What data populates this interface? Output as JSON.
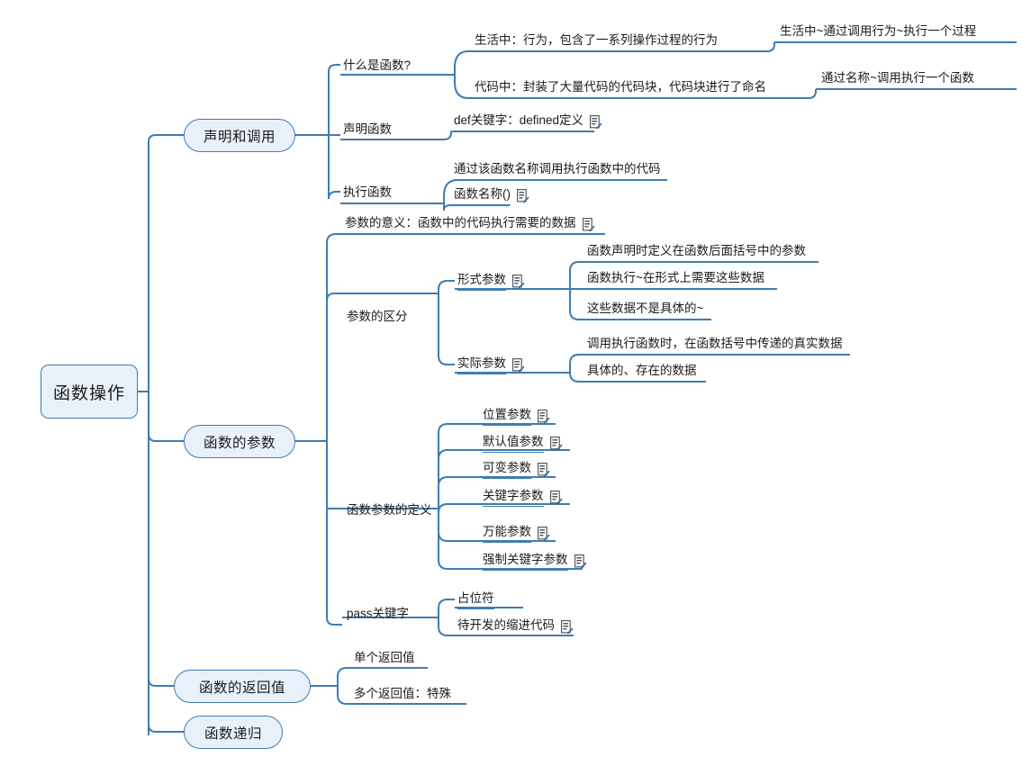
{
  "theme": {
    "node_fill": "#e8f1f9",
    "node_border": "#3f7cb0",
    "line_color": "#3f7cb0",
    "text_color": "#1b1b1b",
    "background": "#ffffff"
  },
  "icons": {
    "note": "note-icon"
  },
  "root": {
    "label": "函数操作"
  },
  "branches": [
    {
      "label": "声明和调用",
      "topics": [
        {
          "label": "什么是函数?",
          "leaves": [
            {
              "text": "生活中：行为，包含了一系列操作过程的行为",
              "note": false,
              "children": [
                {
                  "text": "生活中~通过调用行为~执行一个过程",
                  "note": false
                }
              ]
            },
            {
              "text": "代码中：封装了大量代码的代码块，代码块进行了命名",
              "note": false,
              "children": [
                {
                  "text": "通过名称~调用执行一个函数",
                  "note": false
                }
              ]
            }
          ]
        },
        {
          "label": "声明函数",
          "leaves": [
            {
              "text": "def关键字：defined定义",
              "note": true
            }
          ]
        },
        {
          "label": "执行函数",
          "leaves": [
            {
              "text": "通过该函数名称调用执行函数中的代码",
              "note": false
            },
            {
              "text": "函数名称()",
              "note": true
            }
          ]
        }
      ]
    },
    {
      "label": "函数的参数",
      "topics": [
        {
          "label": "参数的意义：函数中的代码执行需要的数据",
          "is_leaf_label": true,
          "note": true,
          "leaves": []
        },
        {
          "label": "参数的区分",
          "leaves": [
            {
              "text": "形式参数",
              "note": true,
              "children": [
                {
                  "text": "函数声明时定义在函数后面括号中的参数",
                  "note": false
                },
                {
                  "text": "函数执行~在形式上需要这些数据",
                  "note": false
                },
                {
                  "text": "这些数据不是具体的~",
                  "note": false
                }
              ]
            },
            {
              "text": "实际参数",
              "note": true,
              "children": [
                {
                  "text": "调用执行函数时，在函数括号中传递的真实数据",
                  "note": false
                },
                {
                  "text": "具体的、存在的数据",
                  "note": false
                }
              ]
            }
          ]
        },
        {
          "label": "函数参数的定义",
          "leaves": [
            {
              "text": "位置参数",
              "note": true
            },
            {
              "text": "默认值参数",
              "note": true
            },
            {
              "text": "可变参数",
              "note": true
            },
            {
              "text": "关键字参数",
              "note": true
            },
            {
              "text": "万能参数",
              "note": true
            },
            {
              "text": "强制关键字参数",
              "note": true
            }
          ]
        },
        {
          "label": "pass关键字",
          "leaves": [
            {
              "text": "占位符",
              "note": false
            },
            {
              "text": "待开发的缩进代码",
              "note": true
            }
          ]
        }
      ]
    },
    {
      "label": "函数的返回值",
      "topics": [
        {
          "label": "",
          "leaves": [
            {
              "text": "单个返回值",
              "note": false
            },
            {
              "text": "多个返回值：特殊",
              "note": false
            }
          ]
        }
      ]
    },
    {
      "label": "函数递归",
      "topics": []
    }
  ],
  "nodes": {
    "root": "函数操作",
    "b1": "声明和调用",
    "b2": "函数的参数",
    "b3": "函数的返回值",
    "b4": "函数递归",
    "t1": "什么是函数?",
    "t2": "声明函数",
    "t3": "执行函数",
    "t4": "参数的意义：函数中的代码执行需要的数据",
    "t5": "参数的区分",
    "t6": "函数参数的定义",
    "t7": "pass关键字",
    "l1": "生活中：行为，包含了一系列操作过程的行为",
    "l1a": "生活中~通过调用行为~执行一个过程",
    "l2": "代码中：封装了大量代码的代码块，代码块进行了命名",
    "l2a": "通过名称~调用执行一个函数",
    "l3": "def关键字：defined定义",
    "l4": "通过该函数名称调用执行函数中的代码",
    "l5": "函数名称()",
    "l6": "形式参数",
    "l6a": "函数声明时定义在函数后面括号中的参数",
    "l6b": "函数执行~在形式上需要这些数据",
    "l6c": "这些数据不是具体的~",
    "l7": "实际参数",
    "l7a": "调用执行函数时，在函数括号中传递的真实数据",
    "l7b": "具体的、存在的数据",
    "l8": "位置参数",
    "l9": "默认值参数",
    "l10": "可变参数",
    "l11": "关键字参数",
    "l12": "万能参数",
    "l13": "强制关键字参数",
    "l14": "占位符",
    "l15": "待开发的缩进代码",
    "l16": "单个返回值",
    "l17": "多个返回值：特殊"
  }
}
